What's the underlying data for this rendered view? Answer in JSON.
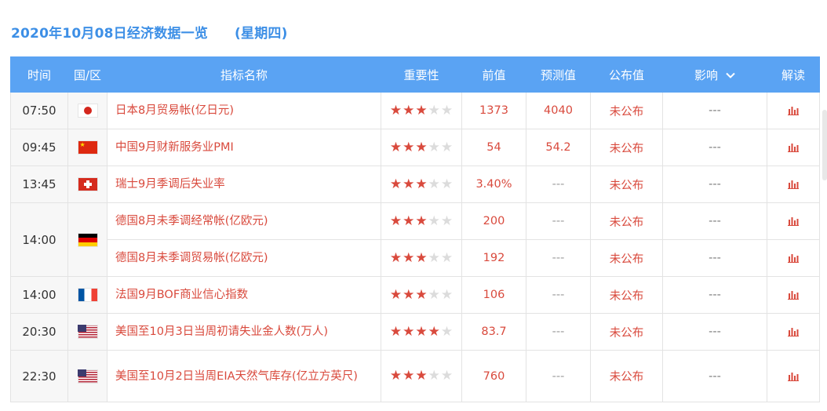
{
  "page": {
    "date_title": "2020年10月08日经济数据一览",
    "weekday": "(星期四)"
  },
  "headers": {
    "time": "时间",
    "region": "国/区",
    "indicator": "指标名称",
    "importance": "重要性",
    "previous": "前值",
    "forecast": "预测值",
    "actual": "公布值",
    "impact": "影响",
    "interpret": "解读"
  },
  "colors": {
    "header_bg": "#5aa3f3",
    "title_blue": "#3d8fe6",
    "accent_red": "#d94a3d"
  },
  "rows": [
    {
      "time": "07:50",
      "country": "japan",
      "flag_icon": "japan-flag-icon",
      "name": "日本8月贸易帐(亿日元)",
      "stars": 3,
      "previous": "1373",
      "forecast": "4040",
      "actual": "未公布",
      "impact": "---"
    },
    {
      "time": "09:45",
      "country": "china",
      "flag_icon": "china-flag-icon",
      "name": "中国9月财新服务业PMI",
      "stars": 3,
      "previous": "54",
      "forecast": "54.2",
      "actual": "未公布",
      "impact": "---"
    },
    {
      "time": "13:45",
      "country": "switzerland",
      "flag_icon": "switzerland-flag-icon",
      "name": "瑞士9月季调后失业率",
      "stars": 3,
      "previous": "3.40%",
      "forecast": "---",
      "actual": "未公布",
      "impact": "---"
    },
    {
      "time": "14:00",
      "country": "germany",
      "flag_icon": "germany-flag-icon",
      "name": "德国8月未季调经常帐(亿欧元)",
      "stars": 3,
      "previous": "200",
      "forecast": "---",
      "actual": "未公布",
      "impact": "---"
    },
    {
      "time": "",
      "country": "germany",
      "flag_icon": "",
      "name": "德国8月未季调贸易帐(亿欧元)",
      "stars": 3,
      "previous": "192",
      "forecast": "---",
      "actual": "未公布",
      "impact": "---"
    },
    {
      "time": "14:00",
      "country": "france",
      "flag_icon": "france-flag-icon",
      "name": "法国9月BOF商业信心指数",
      "stars": 3,
      "previous": "106",
      "forecast": "---",
      "actual": "未公布",
      "impact": "---"
    },
    {
      "time": "20:30",
      "country": "usa",
      "flag_icon": "usa-flag-icon",
      "name": "美国至10月3日当周初请失业金人数(万人)",
      "stars": 4,
      "previous": "83.7",
      "forecast": "---",
      "actual": "未公布",
      "impact": "---"
    },
    {
      "time": "22:30",
      "country": "usa",
      "flag_icon": "usa-flag-icon",
      "name": "美国至10月2日当周EIA天然气库存(亿立方英尺)",
      "stars": 3,
      "previous": "760",
      "forecast": "---",
      "actual": "未公布",
      "impact": "---"
    }
  ]
}
